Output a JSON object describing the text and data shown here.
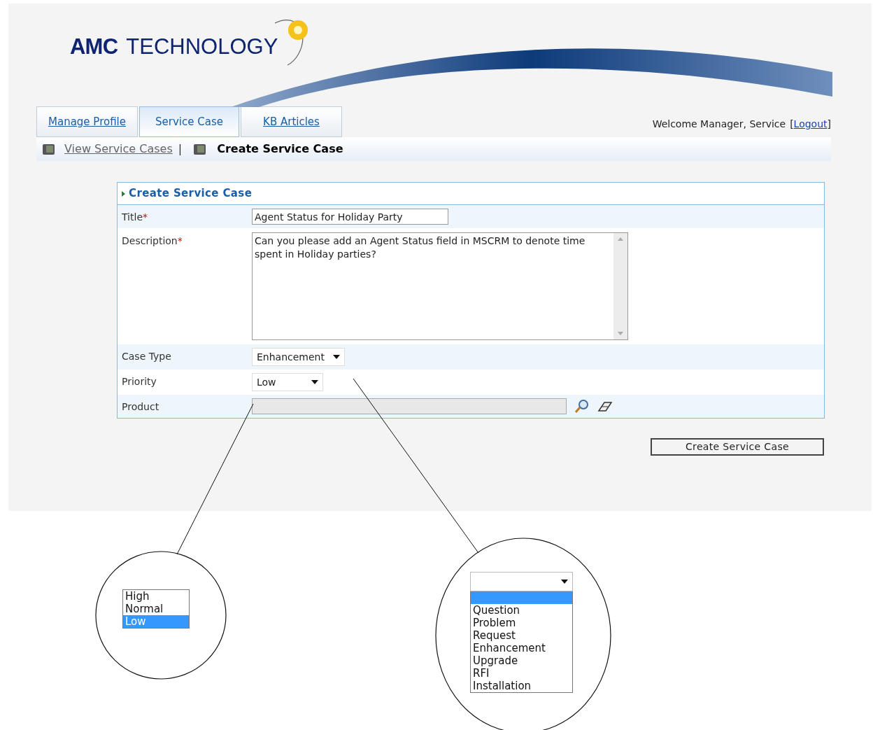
{
  "logo": {
    "bold": "AMC",
    "rest": "TECHNOLOGY"
  },
  "tabs": [
    {
      "label": "Manage Profile",
      "selected": false
    },
    {
      "label": "Service Case",
      "selected": true
    },
    {
      "label": "KB Articles",
      "selected": false
    }
  ],
  "welcome": {
    "text": "Welcome Manager, Service",
    "bracket_open": "[",
    "link": "Logout",
    "bracket_close": "]"
  },
  "breadcrumb": [
    {
      "label": "View Service Cases",
      "kind": "link"
    },
    {
      "label": "|",
      "kind": "separator"
    },
    {
      "label": "Create Service Case",
      "kind": "current"
    }
  ],
  "form": {
    "title": "Create Service Case",
    "fields": [
      {
        "label": "Title",
        "required_mark": "*",
        "kind": "text",
        "value": "Agent Status for Holiday Party"
      },
      {
        "label": "Description",
        "required_mark": "*",
        "kind": "textarea",
        "value": "Can you please add an Agent Status field in MSCRM to denote time spent in Holiday parties?"
      },
      {
        "label": "Case Type",
        "kind": "select",
        "value": "Enhancement"
      },
      {
        "label": "Priority",
        "kind": "select",
        "value": "Low"
      },
      {
        "label": "Product",
        "kind": "lookup"
      }
    ]
  },
  "submit": "Create Service Case",
  "callouts": [
    {
      "kind": "list",
      "options": [
        {
          "label": "High",
          "selected": false
        },
        {
          "label": "Normal",
          "selected": false
        },
        {
          "label": "Low",
          "selected": true
        }
      ]
    },
    {
      "kind": "dropdown",
      "blank_selected": true,
      "options": [
        {
          "label": "Question",
          "selected": false
        },
        {
          "label": "Problem",
          "selected": false
        },
        {
          "label": "Request",
          "selected": false
        },
        {
          "label": "Enhancement",
          "selected": false
        },
        {
          "label": "Upgrade",
          "selected": false
        },
        {
          "label": "RFI",
          "selected": false
        },
        {
          "label": "Installation",
          "selected": false
        }
      ]
    }
  ]
}
